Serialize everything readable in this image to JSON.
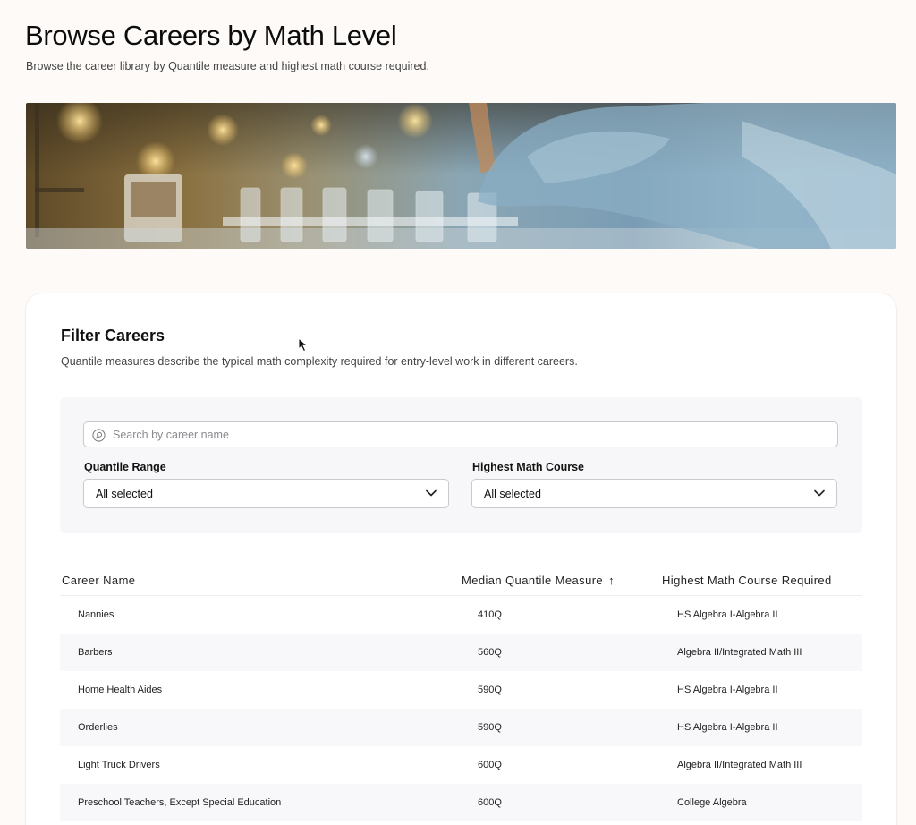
{
  "header": {
    "title": "Browse Careers by Math Level",
    "subtitle": "Browse the career library by Quantile measure and highest math course required."
  },
  "hero": {
    "image": "laboratory-test-tubes-photo"
  },
  "filters": {
    "title": "Filter Careers",
    "description": "Quantile measures describe the typical math complexity required for entry-level work in different careers.",
    "search_placeholder": "Search by career name",
    "search_value": "",
    "quantile_range": {
      "label": "Quantile Range",
      "value": "All selected"
    },
    "math_course": {
      "label": "Highest Math Course",
      "value": "All selected"
    }
  },
  "table": {
    "columns": {
      "career_name": "Career Name",
      "median_quantile": "Median Quantile Measure",
      "math_course": "Highest Math Course Required"
    },
    "sort": {
      "column": "median_quantile",
      "direction": "ascending",
      "indicator": "↑"
    },
    "rows": [
      {
        "career": "Nannies",
        "quantile": "410Q",
        "course": "HS Algebra I-Algebra II"
      },
      {
        "career": "Barbers",
        "quantile": "560Q",
        "course": "Algebra II/Integrated Math III"
      },
      {
        "career": "Home Health Aides",
        "quantile": "590Q",
        "course": "HS Algebra I-Algebra II"
      },
      {
        "career": "Orderlies",
        "quantile": "590Q",
        "course": "HS Algebra I-Algebra II"
      },
      {
        "career": "Light Truck Drivers",
        "quantile": "600Q",
        "course": "Algebra II/Integrated Math III"
      },
      {
        "career": "Preschool Teachers, Except Special Education",
        "quantile": "600Q",
        "course": "College Algebra"
      }
    ]
  },
  "icons": {
    "search": "search-icon",
    "dropdown": "chevron-down-icon",
    "sort": "arrow-up-icon",
    "cursor": "mouse-pointer-icon"
  },
  "colors": {
    "page_background": "#fdfaf8",
    "card_background": "#ffffff",
    "panel_background": "#f7f7f9",
    "alt_row": "#f8f8fa",
    "border": "#c9c9cf"
  }
}
